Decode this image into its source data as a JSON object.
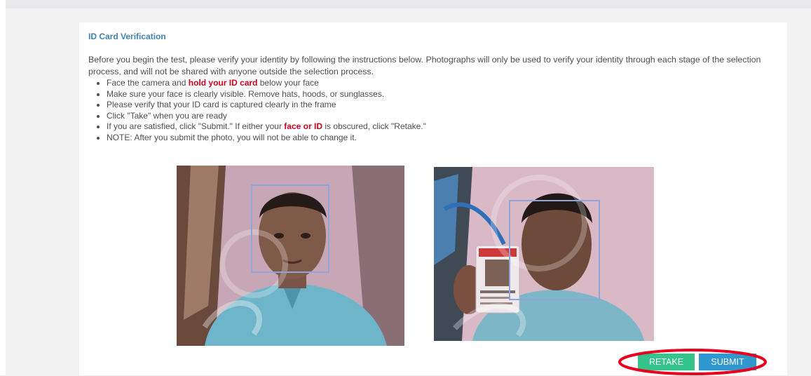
{
  "card": {
    "title": "ID Card Verification",
    "intro": "Before you begin the test, please verify your identity by following the instructions below. Photographs will only be used to verify your identity through each stage of the selection process, and will not be shared with anyone outside the selection process."
  },
  "instructions": {
    "item1": {
      "pre": "Face the camera and ",
      "highlight": "hold your ID card",
      "post": " below your face"
    },
    "item2": "Make sure your face is clearly visible. Remove hats, hoods, or sunglasses.",
    "item3": "Please verify that your ID card is captured clearly in the frame",
    "item4": "Click \"Take\" when you are ready",
    "item5": {
      "pre": "If you are satisfied, click \"Submit.\" If either your ",
      "highlight": "face or ID",
      "post": " is obscured, click \"Retake.\""
    },
    "item6": "NOTE: After you submit the photo, you will not be able to change it."
  },
  "buttons": {
    "retake": "RETAKE",
    "submit": "SUBMIT"
  },
  "colors": {
    "title": "#3f83b1",
    "highlight_text": "#d0021b",
    "retake_button": "#34c48b",
    "submit_button": "#2f98d0",
    "annotation_ellipse": "#e8001c",
    "face_box": "#8fa4d8"
  }
}
